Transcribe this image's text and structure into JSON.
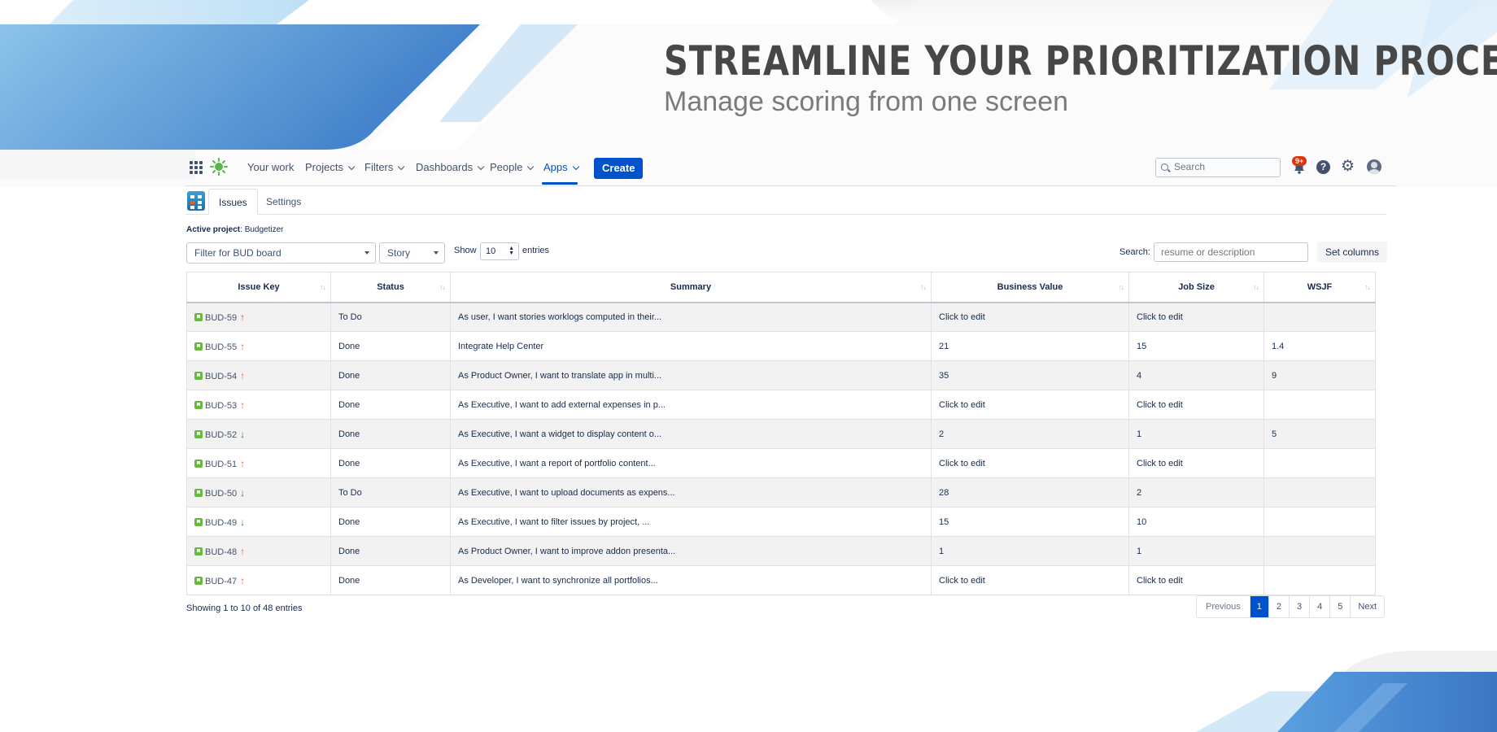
{
  "hero": {
    "title": "STREAMLINE YOUR PRIORITIZATION PROCESS",
    "subtitle": "Manage scoring from one screen"
  },
  "nav": {
    "items": [
      "Your work",
      "Projects",
      "Filters",
      "Dashboards",
      "People",
      "Apps"
    ],
    "active": "Apps",
    "create_label": "Create",
    "search_placeholder": "Search",
    "notification_count": "9+",
    "help_glyph": "?",
    "settings_glyph": "⚙"
  },
  "tabs": [
    "Issues",
    "Settings"
  ],
  "active_project": {
    "label": "Active project",
    "value": ": Budgetizer"
  },
  "controls": {
    "board_filter": "Filter for BUD board",
    "type_filter": "Story",
    "show_label": "Show",
    "entries_value": "10",
    "entries_label": "entries",
    "search_label": "Search:",
    "search_placeholder": "resume or description",
    "set_columns_label": "Set columns"
  },
  "table": {
    "columns": [
      "Issue Key",
      "Status",
      "Summary",
      "Business Value",
      "Job Size",
      "WSJF"
    ],
    "rows": [
      {
        "key": "BUD-59",
        "priority": "highest",
        "status": "To Do",
        "summary": "As user, I want stories worklogs computed in their...",
        "business_value": "Click to edit",
        "job_size": "Click to edit",
        "wsjf": ""
      },
      {
        "key": "BUD-55",
        "priority": "high",
        "status": "Done",
        "summary": "Integrate Help Center",
        "business_value": "21",
        "job_size": "15",
        "wsjf": "1.4"
      },
      {
        "key": "BUD-54",
        "priority": "high",
        "status": "Done",
        "summary": "As Product Owner, I want to translate app in multi...",
        "business_value": "35",
        "job_size": "4",
        "wsjf": "9"
      },
      {
        "key": "BUD-53",
        "priority": "high",
        "status": "Done",
        "summary": "As Executive, I want to add external expenses in p...",
        "business_value": "Click to edit",
        "job_size": "Click to edit",
        "wsjf": ""
      },
      {
        "key": "BUD-52",
        "priority": "low",
        "status": "Done",
        "summary": "As Executive, I want a widget to display content o...",
        "business_value": "2",
        "job_size": "1",
        "wsjf": "5"
      },
      {
        "key": "BUD-51",
        "priority": "high",
        "status": "Done",
        "summary": "As Executive, I want a report of portfolio content...",
        "business_value": "Click to edit",
        "job_size": "Click to edit",
        "wsjf": ""
      },
      {
        "key": "BUD-50",
        "priority": "low",
        "status": "To Do",
        "summary": "As Executive, I want to upload documents as expens...",
        "business_value": "28",
        "job_size": "2",
        "wsjf": ""
      },
      {
        "key": "BUD-49",
        "priority": "low",
        "status": "Done",
        "summary": "As Executive, I want to filter issues by project, ...",
        "business_value": "15",
        "job_size": "10",
        "wsjf": ""
      },
      {
        "key": "BUD-48",
        "priority": "high",
        "status": "Done",
        "summary": "As Product Owner, I want to improve addon presenta...",
        "business_value": "1",
        "job_size": "1",
        "wsjf": ""
      },
      {
        "key": "BUD-47",
        "priority": "high",
        "status": "Done",
        "summary": "As Developer, I want to synchronize all portfolios...",
        "business_value": "Click to edit",
        "job_size": "Click to edit",
        "wsjf": ""
      }
    ]
  },
  "footer": {
    "showing": "Showing 1 to 10 of 48 entries",
    "pagination": [
      "Previous",
      "1",
      "2",
      "3",
      "4",
      "5",
      "Next"
    ],
    "current_page": "1"
  },
  "icons": {
    "priority_up": "↑",
    "priority_down": "↓",
    "sort": "↑↓"
  },
  "colors": {
    "accent": "#0052cc",
    "story": "#63ba3c",
    "priority_highest": "#d04437",
    "priority_high": "#f15c26",
    "priority_low": "#2a8735",
    "badge": "#de350b"
  }
}
